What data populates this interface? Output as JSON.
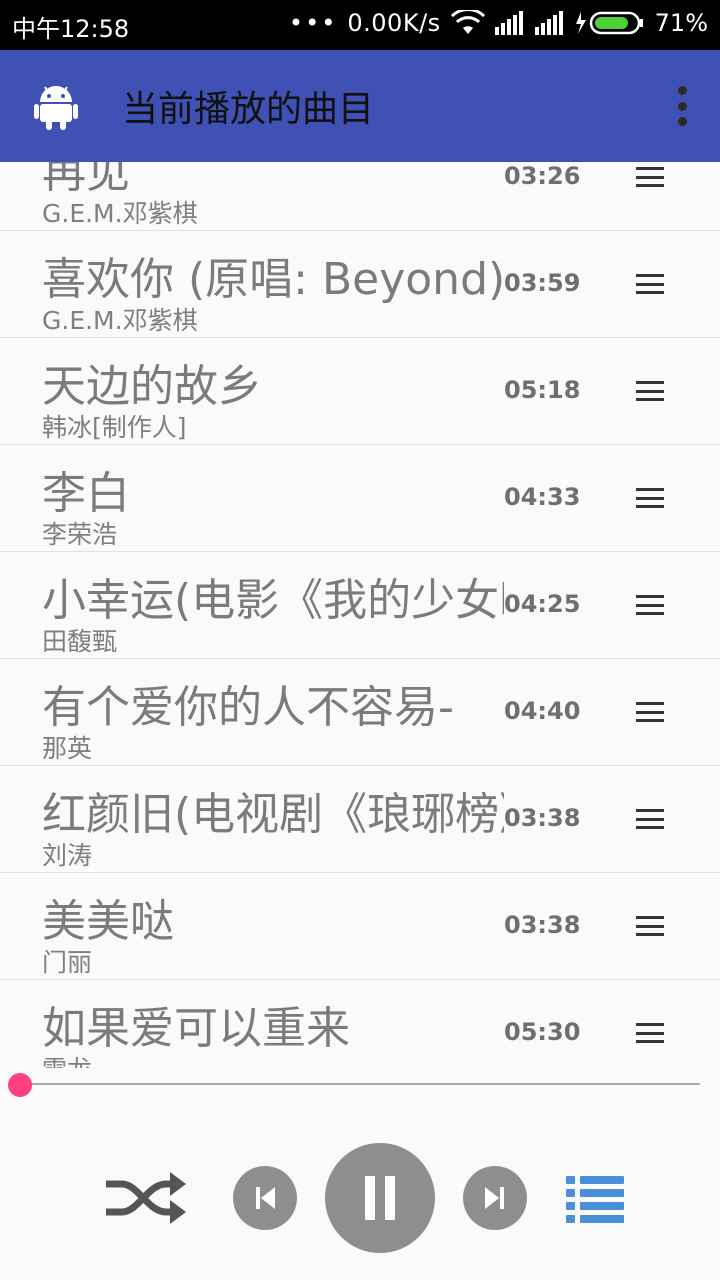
{
  "status_bar": {
    "time": "中午12:58",
    "dots": "•••",
    "network_speed": "0.00K/s",
    "battery": "71%"
  },
  "app_bar": {
    "title": "当前播放的曲目",
    "logo_icon": "android-icon",
    "menu_icon": "more-vert-icon"
  },
  "tracks": [
    {
      "title": "再见",
      "artist": "G.E.M.邓紫棋",
      "duration": "03:26"
    },
    {
      "title": "喜欢你 (原唱: Beyond)",
      "artist": "G.E.M.邓紫棋",
      "duration": "03:59"
    },
    {
      "title": "天边的故乡",
      "artist": "韩冰[制作人]",
      "duration": "05:18"
    },
    {
      "title": "李白",
      "artist": "李荣浩",
      "duration": "04:33"
    },
    {
      "title": "小幸运(电影《我的少女时代》",
      "artist": "田馥甄",
      "duration": "04:25"
    },
    {
      "title": "有个爱你的人不容易-",
      "artist": "那英",
      "duration": "04:40"
    },
    {
      "title": "红颜旧(电视剧《琅琊榜》",
      "artist": "刘涛",
      "duration": "03:38"
    },
    {
      "title": "美美哒",
      "artist": "门丽",
      "duration": "03:38"
    },
    {
      "title": "如果爱可以重来",
      "artist": "雷龙",
      "duration": "05:30"
    }
  ],
  "player": {
    "progress": 0,
    "accent_color": "#ff4081",
    "appbar_color": "#3f51b5",
    "controls": [
      "shuffle-icon",
      "previous-icon",
      "pause-icon",
      "next-icon",
      "queue-list-icon"
    ]
  }
}
